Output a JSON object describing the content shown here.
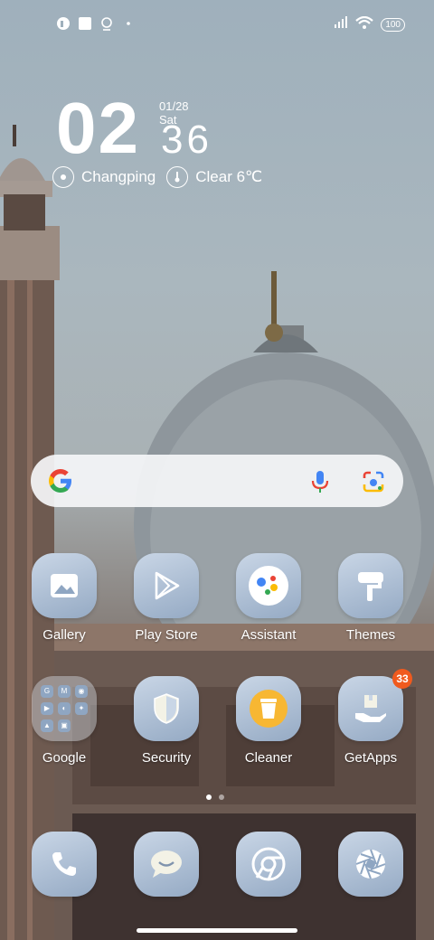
{
  "status_bar": {
    "battery": "100",
    "left_icons": [
      "app-notification-icon",
      "square-notification-icon",
      "pin-notification-icon",
      "dot-notification-icon"
    ],
    "right_icons": [
      "signal-icon",
      "wifi-icon",
      "battery-icon"
    ]
  },
  "clock": {
    "hour": "02",
    "minute": "36",
    "date": "01/28 Sat"
  },
  "weather": {
    "location": "Changping",
    "condition": "Clear 6℃"
  },
  "search": {
    "icons": [
      "google-logo-icon",
      "mic-icon",
      "lens-icon"
    ]
  },
  "apps_row1": [
    {
      "label": "Gallery",
      "icon": "gallery-icon"
    },
    {
      "label": "Play Store",
      "icon": "play-store-icon"
    },
    {
      "label": "Assistant",
      "icon": "assistant-icon"
    },
    {
      "label": "Themes",
      "icon": "themes-icon"
    }
  ],
  "apps_row2": [
    {
      "label": "Google",
      "icon": "google-folder-icon",
      "folder_items": [
        "G",
        "M",
        "◉",
        "▶",
        "◐",
        "✦",
        "▲",
        "▣"
      ]
    },
    {
      "label": "Security",
      "icon": "security-icon"
    },
    {
      "label": "Cleaner",
      "icon": "cleaner-icon"
    },
    {
      "label": "GetApps",
      "icon": "getapps-icon",
      "badge": "33"
    }
  ],
  "dock": [
    {
      "icon": "phone-icon"
    },
    {
      "icon": "messages-icon"
    },
    {
      "icon": "chrome-icon"
    },
    {
      "icon": "camera-icon"
    }
  ],
  "page_indicator": {
    "total": 2,
    "current": 1
  }
}
